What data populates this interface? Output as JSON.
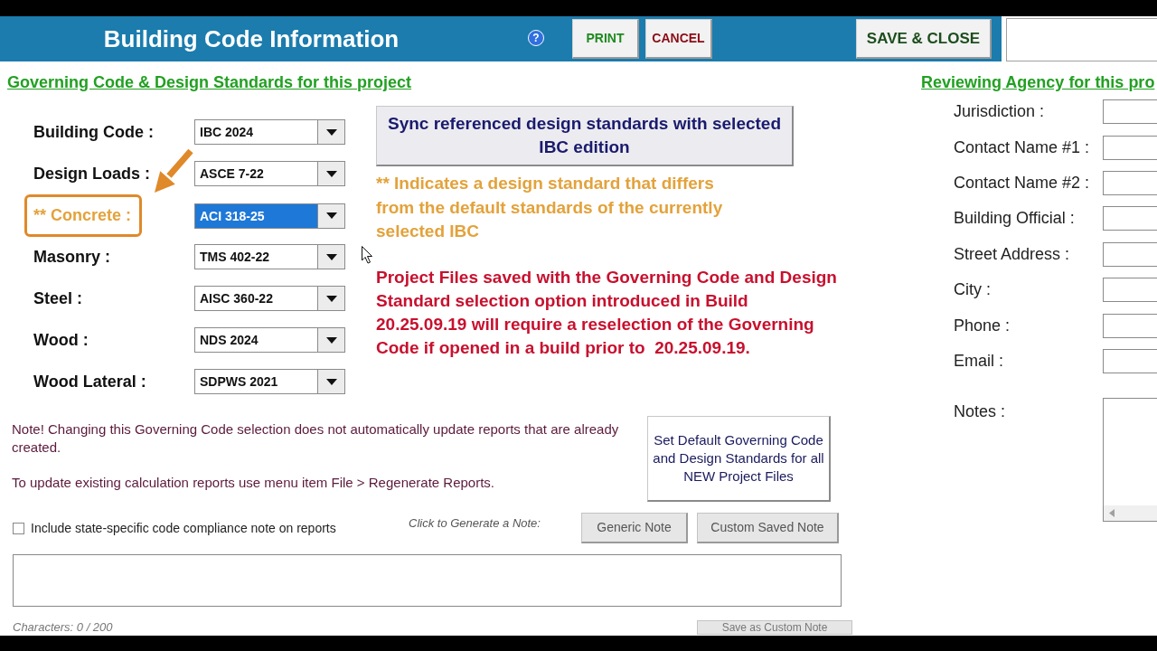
{
  "window": {
    "title": "Building Code Information"
  },
  "help": {
    "symbol": "?"
  },
  "buttons": [
    {
      "label": "PRINT",
      "kind": "print"
    },
    {
      "label": "CANCEL",
      "kind": "cancel"
    },
    {
      "label": "SAVE & CLOSE",
      "kind": "save"
    }
  ],
  "governing": {
    "heading": "Governing Code & Design Standards for this project",
    "standards": [
      {
        "label": "Building Code :",
        "value": "IBC 2024",
        "differs_from_default": false,
        "focused": false,
        "callout": false
      },
      {
        "label": "Design Loads :",
        "value": "ASCE 7-22",
        "differs_from_default": false,
        "focused": false,
        "callout": false
      },
      {
        "label": "** Concrete :",
        "value": "ACI 318-25",
        "differs_from_default": true,
        "focused": true,
        "callout": true
      },
      {
        "label": "Masonry :",
        "value": "TMS 402-22",
        "differs_from_default": false,
        "focused": false,
        "callout": false
      },
      {
        "label": "Steel :",
        "value": "AISC 360-22",
        "differs_from_default": false,
        "focused": false,
        "callout": false
      },
      {
        "label": "Wood :",
        "value": "NDS 2024",
        "differs_from_default": false,
        "focused": false,
        "callout": false
      },
      {
        "label": "Wood Lateral :",
        "value": "SDPWS 2021",
        "differs_from_default": false,
        "focused": false,
        "callout": false
      }
    ],
    "sync_button": "Sync referenced design standards with selected IBC edition",
    "legend": "** Indicates a design standard that differs from the default standards of the currently selected IBC",
    "warning": "Project Files saved with the Governing Code and Design Standard selection option introduced in Build 20.25.09.19 will require a reselection of the Governing Code if opened in a build prior to  20.25.09.19.",
    "notices": [
      "Note! Changing this Governing Code selection does not automatically update reports that are already created.",
      "To update existing calculation reports use menu item File > Regenerate Reports."
    ],
    "default_button": "Set Default Governing Code and Design Standards for all NEW Project Files"
  },
  "compliance_note": {
    "checkbox": {
      "label": "Include state-specific code compliance note on reports",
      "checked": false
    },
    "prompt": "Click to Generate a Note:",
    "generate_buttons": [
      "Generic Note",
      "Custom Saved Note"
    ],
    "counter": "Characters: 0 / 200",
    "save_button": "Save as Custom Note"
  },
  "reviewing_agency": {
    "heading": "Reviewing Agency for this pro",
    "fields": [
      {
        "label": "Jurisdiction :"
      },
      {
        "label": "Contact Name #1 :"
      },
      {
        "label": "Contact Name #2 :"
      },
      {
        "label": "Building Official :"
      },
      {
        "label": "Street Address :"
      },
      {
        "label": "City :"
      },
      {
        "label": "Phone :"
      },
      {
        "label": "Email :"
      }
    ],
    "notes": {
      "label": "Notes :"
    }
  }
}
